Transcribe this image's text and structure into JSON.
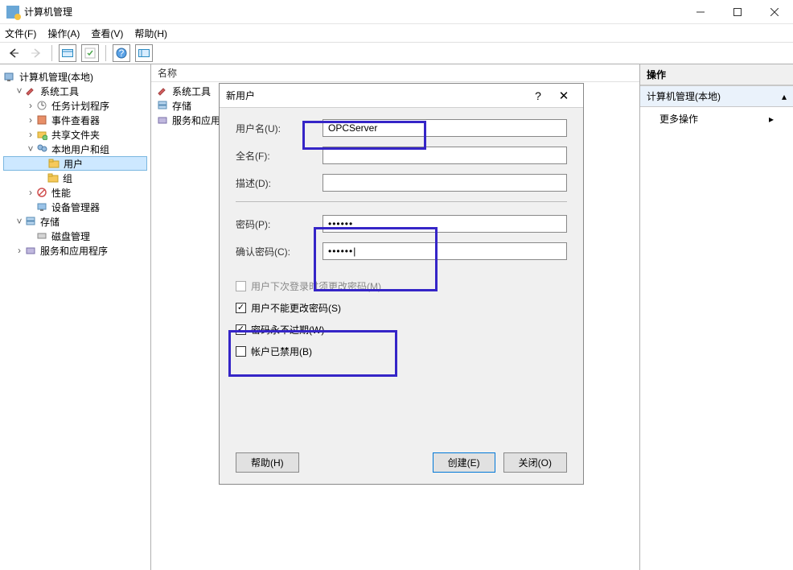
{
  "window": {
    "title": "计算机管理"
  },
  "menu": [
    "文件(F)",
    "操作(A)",
    "查看(V)",
    "帮助(H)"
  ],
  "tree": {
    "root": "计算机管理(本地)",
    "systools": "系统工具",
    "task": "任务计划程序",
    "event": "事件查看器",
    "share": "共享文件夹",
    "localusers": "本地用户和组",
    "users": "用户",
    "groups": "组",
    "perf": "性能",
    "devmgr": "设备管理器",
    "storage": "存储",
    "diskmgr": "磁盘管理",
    "services": "服务和应用程序"
  },
  "listheader": "名称",
  "listitems": [
    "系统工具",
    "存储",
    "服务和应用"
  ],
  "right": {
    "header": "操作",
    "context": "计算机管理(本地)",
    "more": "更多操作"
  },
  "dialog": {
    "title": "新用户",
    "labels": {
      "username": "用户名(U):",
      "fullname": "全名(F):",
      "desc": "描述(D):",
      "password": "密码(P):",
      "confirm": "确认密码(C):"
    },
    "values": {
      "username": "OPCServer",
      "fullname": "",
      "desc": "",
      "password": "••••••",
      "confirm": "••••••|"
    },
    "checks": {
      "mustchange": "用户下次登录时须更改密码(M)",
      "cannotchange": "用户不能更改密码(S)",
      "neverexpire": "密码永不过期(W)",
      "disabled": "帐户已禁用(B)"
    },
    "buttons": {
      "help": "帮助(H)",
      "create": "创建(E)",
      "close": "关闭(O)"
    }
  }
}
